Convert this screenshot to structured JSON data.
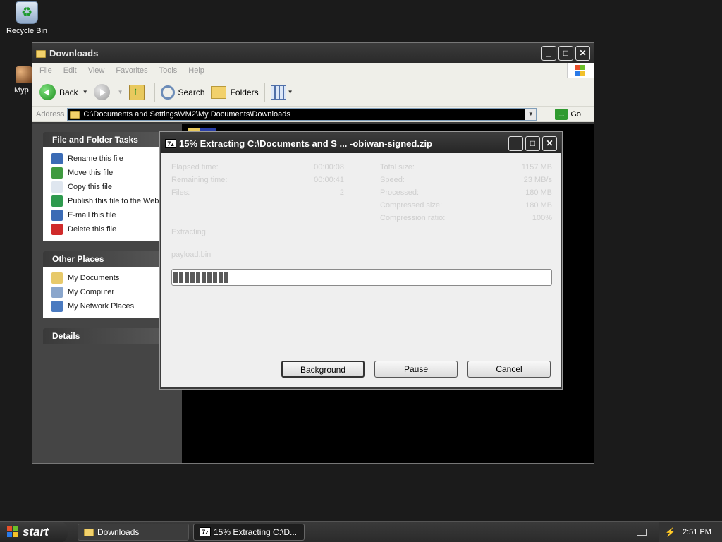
{
  "desktop": {
    "recycle_bin_label": "Recycle Bin",
    "partial_icon_label": "Myp"
  },
  "explorer": {
    "title": "Downloads",
    "menu": [
      "File",
      "Edit",
      "View",
      "Favorites",
      "Tools",
      "Help"
    ],
    "toolbar": {
      "back_label": "Back",
      "search_label": "Search",
      "folders_label": "Folders"
    },
    "address": {
      "label": "Address",
      "value": "C:\\Documents and Settings\\VM2\\My Documents\\Downloads",
      "go_label": "Go"
    },
    "file_tasks": {
      "title": "File and Folder Tasks",
      "items": [
        {
          "label": "Rename this file",
          "icon": "rename-icon",
          "color": "#3b6bb5"
        },
        {
          "label": "Move this file",
          "icon": "move-icon",
          "color": "#3f9a3f"
        },
        {
          "label": "Copy this file",
          "icon": "copy-icon",
          "color": "#dfe6ef"
        },
        {
          "label": "Publish this file to the Web",
          "icon": "globe-icon",
          "color": "#2e9a4e"
        },
        {
          "label": "E-mail this file",
          "icon": "email-icon",
          "color": "#3b6bb5"
        },
        {
          "label": "Delete this file",
          "icon": "delete-icon",
          "color": "#d02a2a"
        }
      ]
    },
    "other_places": {
      "title": "Other Places",
      "items": [
        {
          "label": "My Documents",
          "icon": "my-documents-icon",
          "color": "#e7c96a"
        },
        {
          "label": "My Computer",
          "icon": "my-computer-icon",
          "color": "#8aa6cc"
        },
        {
          "label": "My Network Places",
          "icon": "network-places-icon",
          "color": "#4a7ac0"
        }
      ]
    },
    "details": {
      "title": "Details"
    }
  },
  "dialog": {
    "title": "15% Extracting C:\\Documents and S ... -obiwan-signed.zip",
    "left_stats": [
      {
        "label": "Elapsed time:",
        "value": "00:00:08"
      },
      {
        "label": "Remaining time:",
        "value": "00:00:41"
      },
      {
        "label": "Files:",
        "value": "2"
      }
    ],
    "right_stats": [
      {
        "label": "Total size:",
        "value": "1157 MB"
      },
      {
        "label": "Speed:",
        "value": "23 MB/s"
      },
      {
        "label": "Processed:",
        "value": "180 MB"
      },
      {
        "label": "Compressed size:",
        "value": "180 MB"
      },
      {
        "label": "Compression ratio:",
        "value": "100%"
      }
    ],
    "status_label": "Extracting",
    "current_file": "payload.bin",
    "progress_percent": 15,
    "buttons": {
      "background": "Background",
      "pause": "Pause",
      "cancel": "Cancel"
    }
  },
  "taskbar": {
    "start_label": "start",
    "tasks": [
      {
        "label": "Downloads",
        "icon": "folder-icon"
      },
      {
        "label": "15% Extracting C:\\D...",
        "icon": "7zip-icon"
      }
    ],
    "clock": "2:51 PM"
  },
  "colors": {
    "accent_dark": "#2a2a2a",
    "xp_red": "#e8502a",
    "xp_green": "#6cbf2a",
    "xp_blue": "#2a7ae8",
    "xp_yellow": "#f2c12a"
  }
}
